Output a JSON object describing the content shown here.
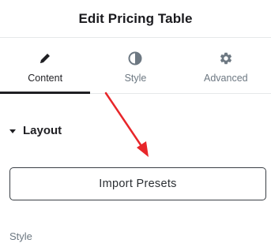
{
  "header": {
    "title": "Edit Pricing Table"
  },
  "tabs": [
    {
      "label": "Content",
      "icon": "pencil-icon",
      "active": true
    },
    {
      "label": "Style",
      "icon": "contrast-icon",
      "active": false
    },
    {
      "label": "Advanced",
      "icon": "gear-icon",
      "active": false
    }
  ],
  "section": {
    "title": "Layout",
    "expanded": true
  },
  "import_button": {
    "label": "Import Presets"
  },
  "style_field": {
    "label": "Style"
  },
  "annotation": {
    "color": "#e8262a"
  }
}
